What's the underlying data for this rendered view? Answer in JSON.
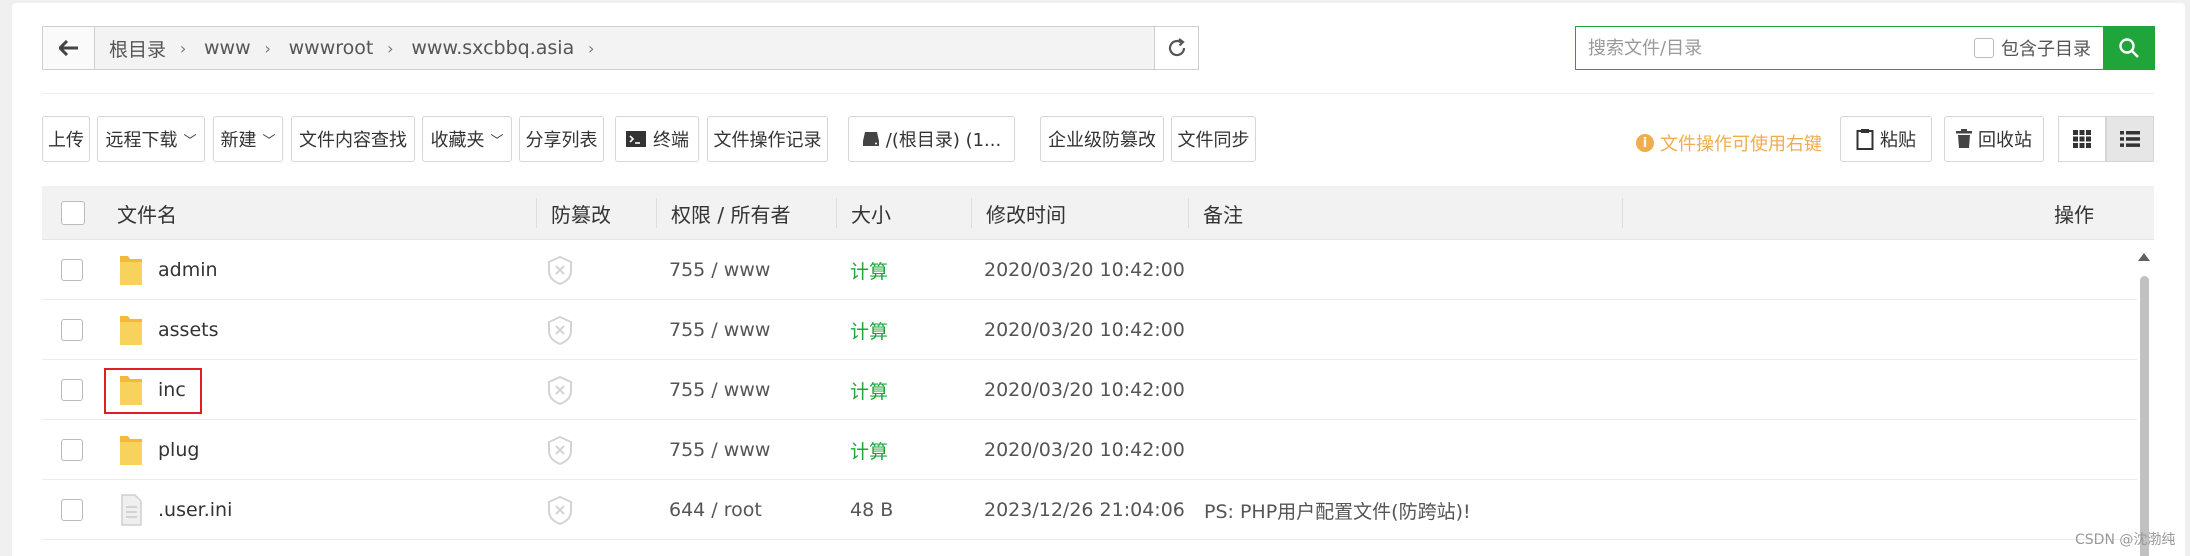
{
  "path": {
    "crumbs": [
      "根目录",
      "www",
      "wwwroot",
      "www.sxcbbq.asia"
    ]
  },
  "search": {
    "placeholder": "搜索文件/目录",
    "subdir_label": "包含子目录"
  },
  "toolbar": {
    "upload": "上传",
    "remote_download": "远程下载",
    "new": "新建",
    "content_search": "文件内容查找",
    "favorites": "收藏夹",
    "share_list": "分享列表",
    "terminal": "终端",
    "op_log": "文件操作记录",
    "disk": "/(根目录) (1...",
    "tamper_proof": "企业级防篡改",
    "file_sync": "文件同步",
    "tip": "文件操作可使用右键",
    "paste": "粘贴",
    "recycle": "回收站"
  },
  "table": {
    "headers": {
      "name": "文件名",
      "tamper": "防篡改",
      "perm": "权限 / 所有者",
      "size": "大小",
      "mtime": "修改时间",
      "note": "备注",
      "action": "操作"
    },
    "rows": [
      {
        "name": "admin",
        "type": "folder",
        "perm": "755 / www",
        "size": "计算",
        "mtime": "2020/03/20 10:42:00",
        "note": ""
      },
      {
        "name": "assets",
        "type": "folder",
        "perm": "755 / www",
        "size": "计算",
        "mtime": "2020/03/20 10:42:00",
        "note": ""
      },
      {
        "name": "inc",
        "type": "folder",
        "perm": "755 / www",
        "size": "计算",
        "mtime": "2020/03/20 10:42:00",
        "note": ""
      },
      {
        "name": "plug",
        "type": "folder",
        "perm": "755 / www",
        "size": "计算",
        "mtime": "2020/03/20 10:42:00",
        "note": ""
      },
      {
        "name": ".user.ini",
        "type": "file",
        "perm": "644 / root",
        "size": "48 B",
        "mtime": "2023/12/26 21:04:06",
        "note": "PS: PHP用户配置文件(防跨站)!"
      }
    ]
  },
  "watermark": "CSDN @沈渤纯",
  "colors": {
    "accent": "#20a53a",
    "warning": "#f0ad4e",
    "highlight": "#e02020",
    "folder": "#f7c94b"
  },
  "icons": {
    "back": "arrow-left-icon",
    "refresh": "refresh-icon",
    "search": "search-icon",
    "folder": "folder-icon",
    "file": "file-icon",
    "shield": "shield-icon",
    "terminal": "terminal-icon",
    "disk": "disk-icon",
    "paste": "clipboard-icon",
    "recycle": "trash-icon",
    "grid_view": "grid-view-icon",
    "list_view": "list-view-icon"
  }
}
